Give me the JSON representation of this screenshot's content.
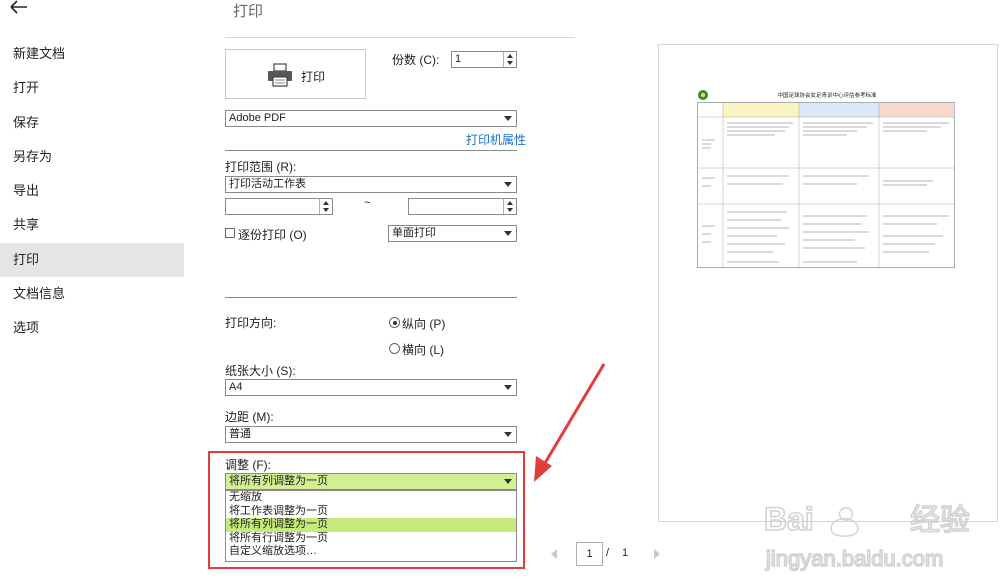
{
  "header": {
    "title": "打印"
  },
  "sidebar": {
    "items": [
      {
        "label": "新建文档"
      },
      {
        "label": "打开"
      },
      {
        "label": "保存"
      },
      {
        "label": "另存为"
      },
      {
        "label": "导出"
      },
      {
        "label": "共享"
      },
      {
        "label": "打印",
        "active": true
      },
      {
        "label": "文档信息"
      },
      {
        "label": "选项"
      }
    ]
  },
  "print": {
    "button_label": "打印",
    "copies_label": "份数 (C):",
    "copies_value": "1",
    "printer_name": "Adobe PDF",
    "printer_properties_link": "打印机属性"
  },
  "range": {
    "label": "打印范围 (R):",
    "selected": "打印活动工作表",
    "separator": "~",
    "collate_label": "逐份打印 (O)",
    "collate_checked": false,
    "sides_selected": "单面打印"
  },
  "orientation": {
    "label": "打印方向:",
    "portrait_label": "纵向 (P)",
    "landscape_label": "横向 (L)",
    "selected": "portrait"
  },
  "paper": {
    "label": "纸张大小 (S):",
    "selected": "A4"
  },
  "margins": {
    "label": "边距 (M):",
    "selected": "普通"
  },
  "scaling": {
    "label": "调整 (F):",
    "selected": "将所有列调整为一页",
    "options": [
      "无缩放",
      "将工作表调整为一页",
      "将所有列调整为一页",
      "将所有行调整为一页",
      "自定义缩放选项…"
    ],
    "highlight_color": "#c7ea7c"
  },
  "preview": {
    "doc_title": "中国足球协会女足青训中心评估参考标准",
    "current_page": "1",
    "page_separator": "/",
    "total_pages": "1"
  },
  "watermark": {
    "brand": "Bai",
    "brand_cn": "经验",
    "url": "jingyan.baidu.com"
  },
  "colors": {
    "accent_link": "#1a6fd1",
    "annotation_red": "#e23d3d",
    "active_nav_bg": "#e5e5e5"
  }
}
